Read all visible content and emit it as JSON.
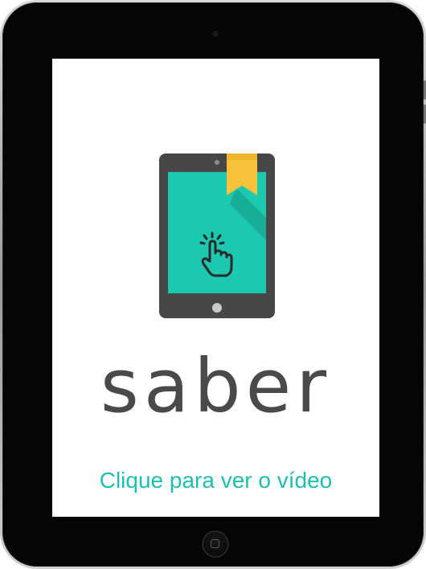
{
  "brand": {
    "name": "saber"
  },
  "cta": {
    "label": "Clique para ver o vídeo"
  },
  "colors": {
    "accent": "#1ec0ad",
    "screen_teal": "#1cc8b0",
    "bookmark": "#f8c33a",
    "brand_text": "#4a4a4a",
    "device_body": "#474747"
  },
  "icons": {
    "illustration": "tablet-touch-icon",
    "bookmark": "bookmark-icon",
    "hand": "hand-tap-icon",
    "home": "home-button"
  }
}
